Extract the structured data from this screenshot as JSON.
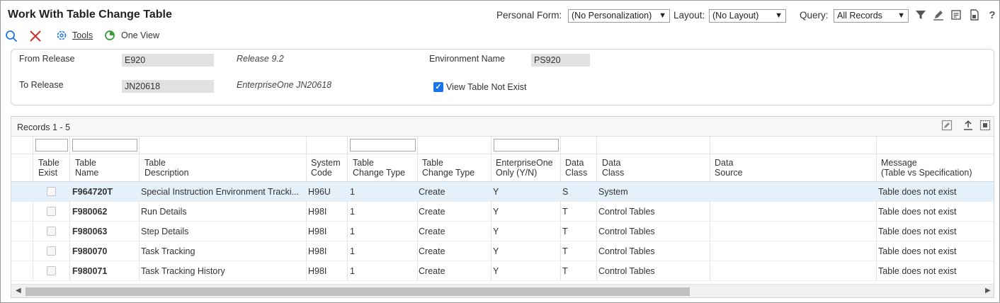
{
  "header": {
    "title": "Work With Table Change Table",
    "personal_form_label": "Personal Form:",
    "personal_form_value": "(No Personalization)",
    "layout_label": "Layout:",
    "layout_value": "(No Layout)",
    "query_label": "Query:",
    "query_value": "All Records",
    "icons": [
      "filter-icon",
      "pencil-icon",
      "notes-icon",
      "export-icon",
      "help-icon"
    ],
    "help_glyph": "?"
  },
  "toolbar": {
    "tools_label": "Tools",
    "oneview_label": "One View",
    "icons": [
      "search-icon",
      "close-icon",
      "gear-icon",
      "one-view-icon"
    ]
  },
  "form": {
    "from_release_label": "From Release",
    "from_release_value": "E920",
    "from_release_desc": "Release 9.2",
    "to_release_label": "To Release",
    "to_release_value": "JN20618",
    "to_release_desc": "EnterpriseOne JN20618",
    "environment_label": "Environment Name",
    "environment_value": "PS920",
    "view_table_label": "View Table Not Exist",
    "view_table_checked": true
  },
  "grid": {
    "records_label": "Records 1 - 5",
    "columns": [
      "Table\nExist",
      "Table\nName",
      "Table\nDescription",
      "System\nCode",
      "Table\nChange Type",
      "Table\nChange Type",
      "EnterpriseOne\nOnly (Y/N)",
      "Data\nClass",
      "Data\nClass",
      "Data\nSource",
      "Message\n(Table vs Specification)"
    ],
    "rows": [
      [
        "",
        "F964720T",
        "Special Instruction Environment Tracki...",
        "H96U",
        "1",
        "Create",
        "Y",
        "S",
        "System",
        "",
        "Table does not exist"
      ],
      [
        "",
        "F980062",
        "Run Details",
        "H98I",
        "1",
        "Create",
        "Y",
        "T",
        "Control Tables",
        "",
        "Table does not exist"
      ],
      [
        "",
        "F980063",
        "Step Details",
        "H98I",
        "1",
        "Create",
        "Y",
        "T",
        "Control Tables",
        "",
        "Table does not exist"
      ],
      [
        "",
        "F980070",
        "Task Tracking",
        "H98I",
        "1",
        "Create",
        "Y",
        "T",
        "Control Tables",
        "",
        "Table does not exist"
      ],
      [
        "",
        "F980071",
        "Task Tracking History",
        "H98I",
        "1",
        "Create",
        "Y",
        "T",
        "Control Tables",
        "",
        "Table does not exist"
      ]
    ],
    "selected_row": 0
  },
  "colors": {
    "accent": "#1a73e8",
    "close_red": "#d0312d",
    "oneview_green": "#3a9d3a",
    "selected_row": "#e4f0fa",
    "field_bg": "#e1e1e1"
  }
}
